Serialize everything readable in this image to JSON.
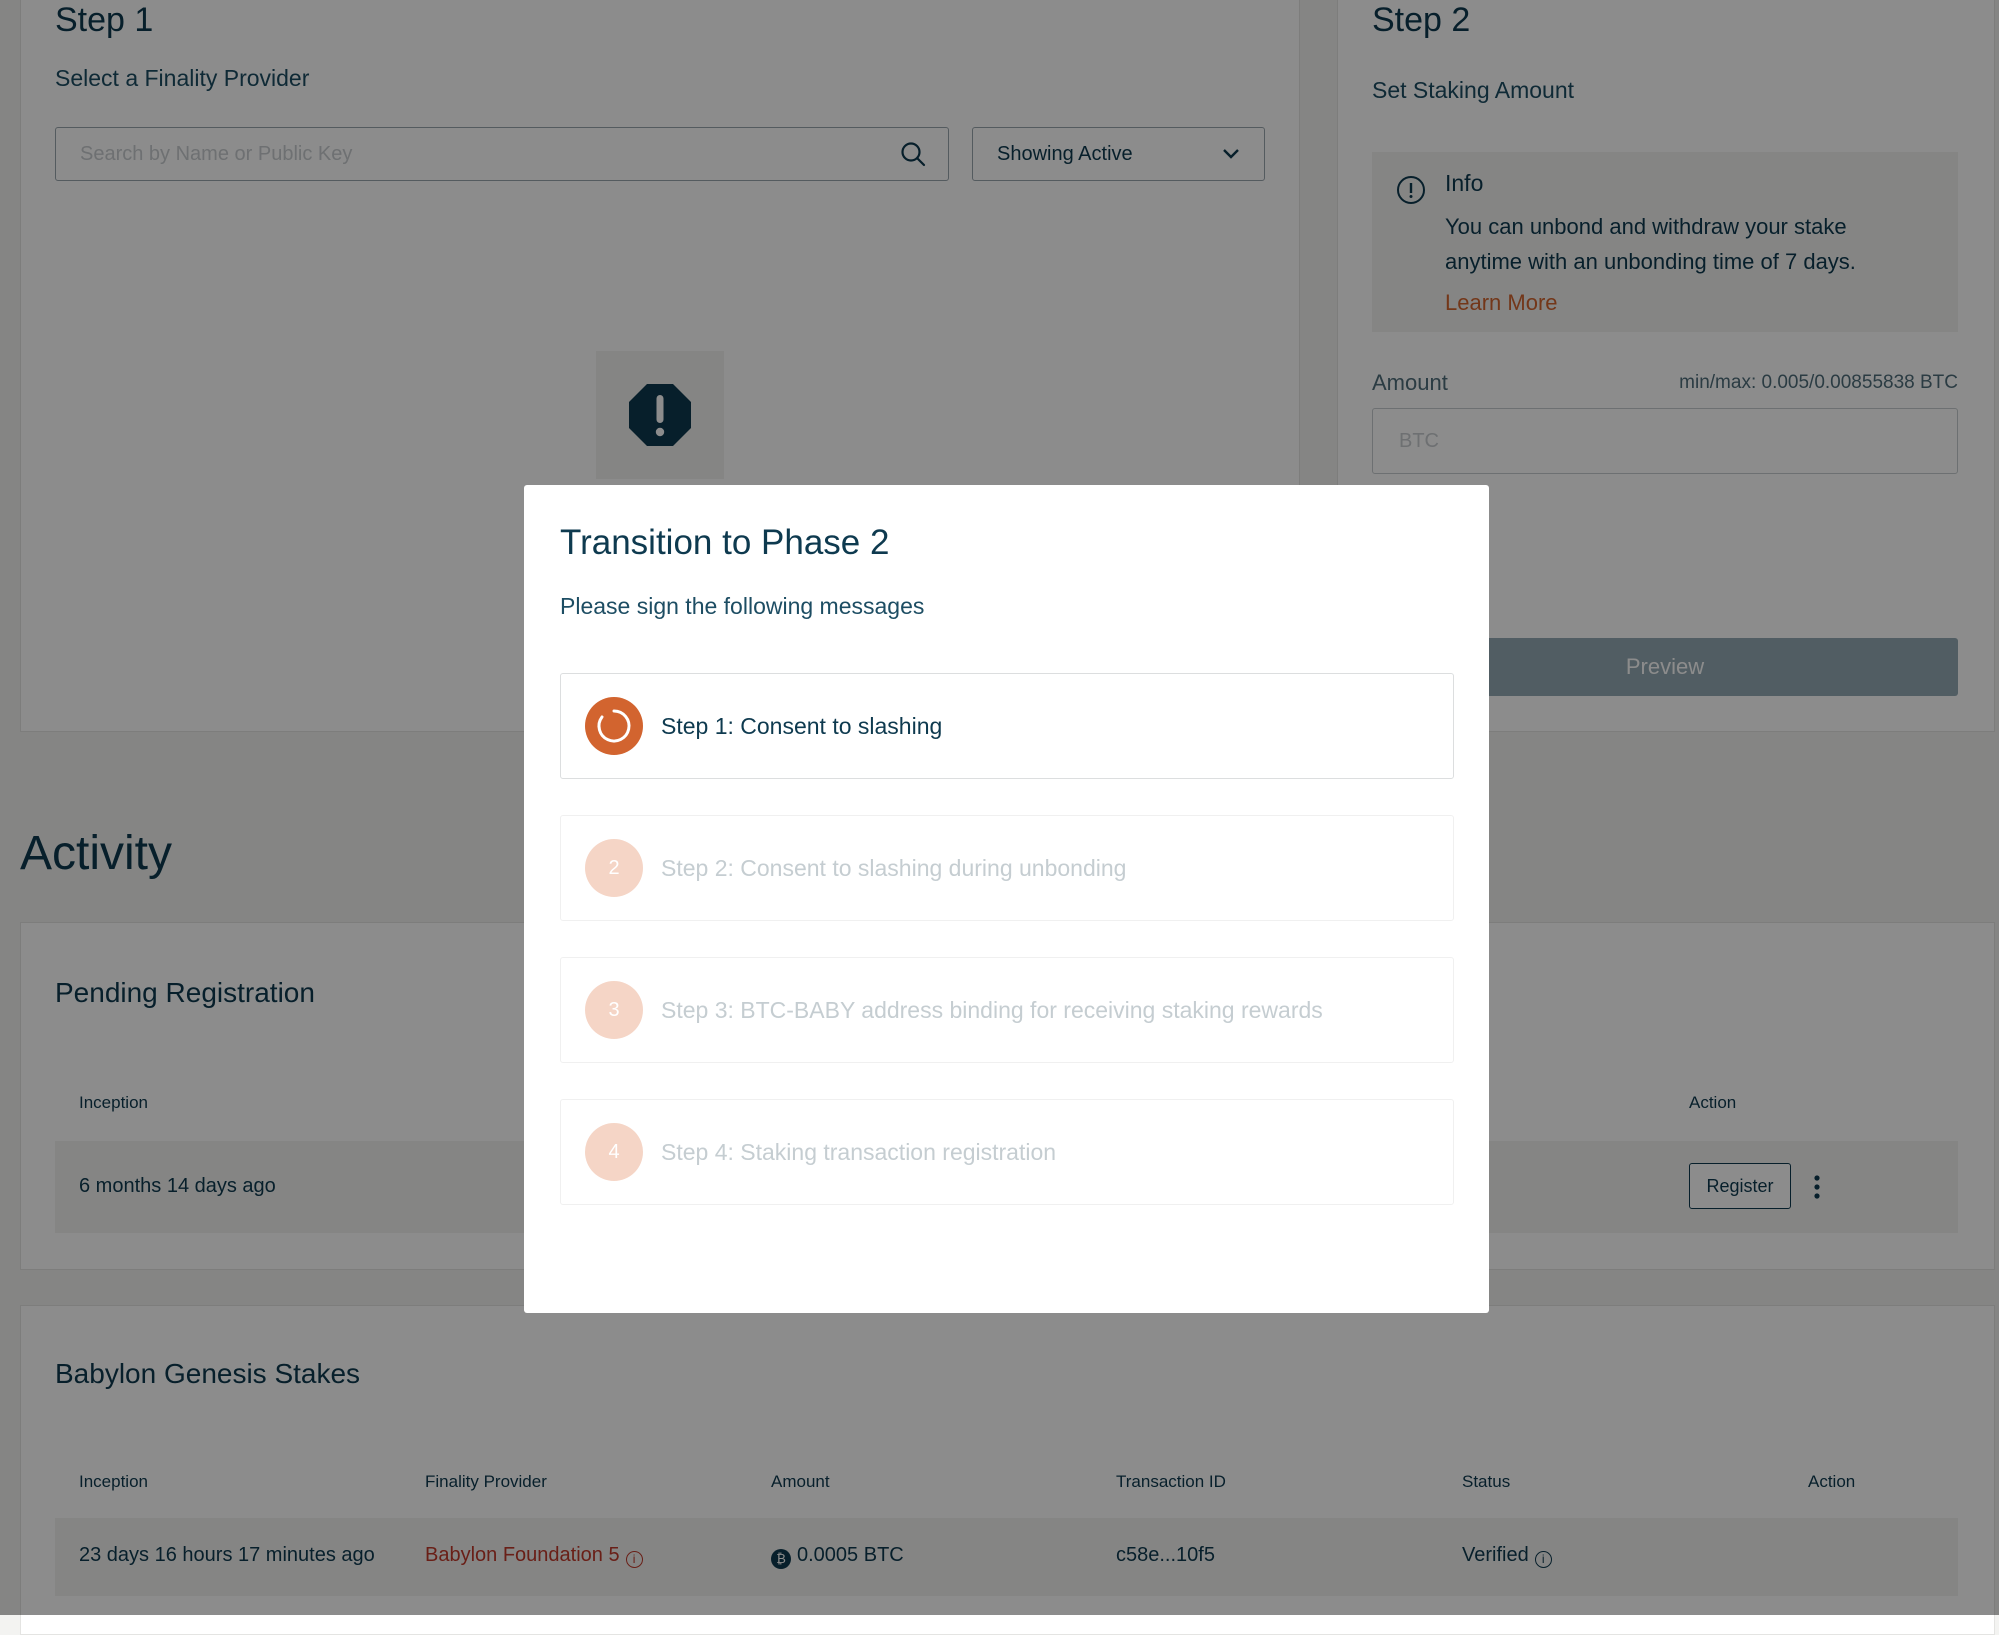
{
  "step1": {
    "title": "Step 1",
    "subtitle": "Select a Finality Provider",
    "search_placeholder": "Search by Name or Public Key",
    "filter_label": "Showing Active"
  },
  "step2": {
    "title": "Step 2",
    "subtitle": "Set Staking Amount",
    "info_title": "Info",
    "info_line1": "You can unbond and withdraw your stake",
    "info_line2": "anytime with an unbonding time of 7 days.",
    "learn_more": "Learn More",
    "amount_label": "Amount",
    "min_max": "min/max: 0.005/0.00855838 BTC",
    "amount_placeholder": "BTC",
    "preview_button": "Preview"
  },
  "activity": {
    "title": "Activity",
    "pending": {
      "title": "Pending Registration",
      "headers": {
        "inception": "Inception",
        "action": "Action"
      },
      "row": {
        "inception": "6 months 14 days ago",
        "register_button": "Register"
      }
    },
    "genesis": {
      "title": "Babylon Genesis Stakes",
      "headers": [
        "Inception",
        "Finality Provider",
        "Amount",
        "Transaction ID",
        "Status",
        "Action"
      ],
      "row": {
        "inception": "23 days 16 hours 17 minutes ago",
        "provider": "Babylon Foundation 5",
        "amount": "0.0005 BTC",
        "tx_id": "c58e...10f5",
        "status": "Verified"
      }
    }
  },
  "modal": {
    "title": "Transition to Phase 2",
    "subtitle": "Please sign the following messages",
    "steps": [
      {
        "number": "1",
        "label": "Step 1: Consent to slashing",
        "state": "active"
      },
      {
        "number": "2",
        "label": "Step 2: Consent to slashing during unbonding",
        "state": "pending"
      },
      {
        "number": "3",
        "label": "Step 3: BTC-BABY address binding for receiving staking rewards",
        "state": "pending"
      },
      {
        "number": "4",
        "label": "Step 4: Staking transaction registration",
        "state": "pending"
      }
    ]
  },
  "colors": {
    "accent": "#d2642f",
    "accent_light": "#f5d5c6",
    "text_primary": "#0e3a4f",
    "provider_red": "#c0392b",
    "preview_disabled": "#94aab4"
  }
}
